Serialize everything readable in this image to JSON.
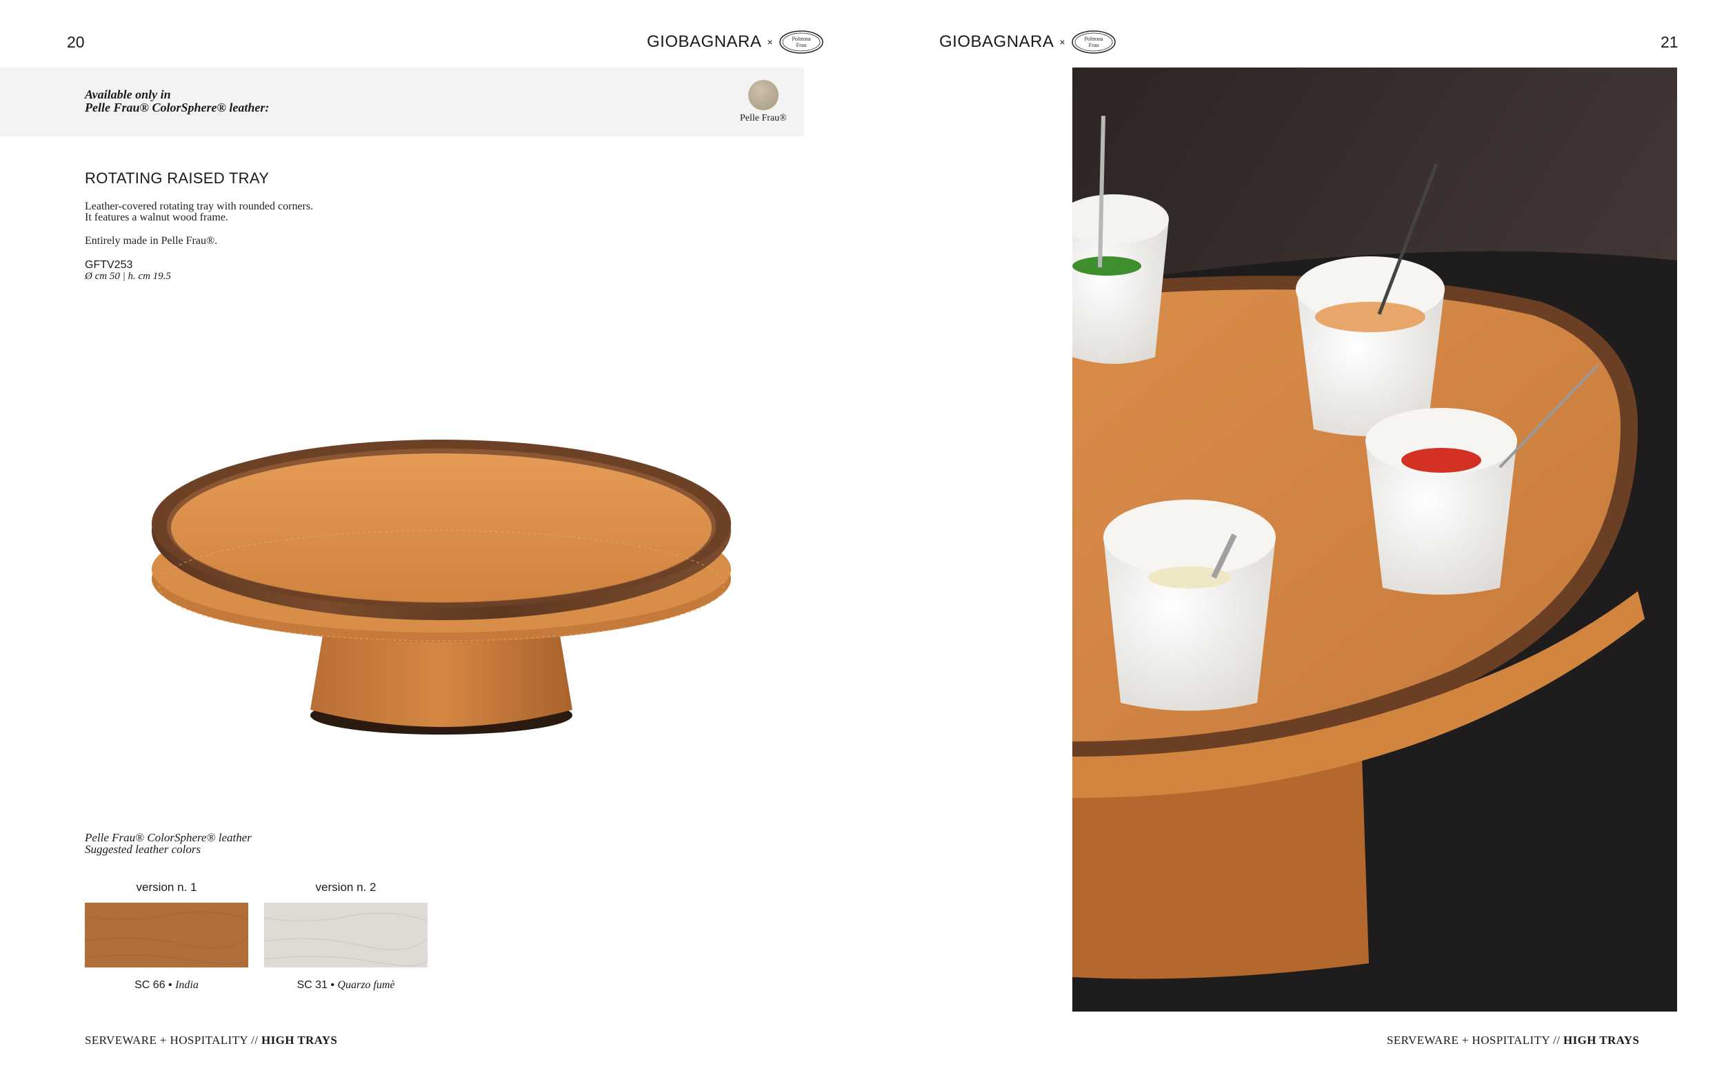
{
  "left_page": {
    "page_number": "20",
    "brand": {
      "name": "GIOBAGNARA",
      "separator": "×",
      "partner_logo": "poltrona-frau-logo",
      "partner_text": [
        "Poltrona",
        "Frau"
      ]
    },
    "availability": {
      "line1": "Available only in",
      "line2": "Pelle Frau® ColorSphere® leather:",
      "swatch_label": "Pelle Frau®",
      "swatch_color": "#b8ab94"
    },
    "product": {
      "title": "ROTATING RAISED TRAY",
      "description_line1": "Leather-covered rotating tray with rounded corners.",
      "description_line2": "It features a walnut wood frame.",
      "material_note": "Entirely made in Pelle Frau®.",
      "code": "GFTV253",
      "dimensions": "Ø cm 50 | h. cm 19.5"
    },
    "colors": {
      "caption_line1": "Pelle Frau® ColorSphere® leather",
      "caption_line2": "Suggested leather colors",
      "versions": [
        {
          "label": "version n. 1",
          "code": "SC 66 •",
          "name": "India",
          "color": "#b8743c"
        },
        {
          "label": "version n. 2",
          "code": "SC 31 •",
          "name": "Quarzo fumè",
          "color": "#dddbd3"
        }
      ]
    },
    "footer": {
      "section": "SERVEWARE + HOSPITALITY //",
      "category": "HIGH TRAYS"
    }
  },
  "right_page": {
    "page_number": "21",
    "brand": {
      "name": "GIOBAGNARA",
      "separator": "×",
      "partner_logo": "poltrona-frau-logo",
      "partner_text": [
        "Poltrona",
        "Frau"
      ]
    },
    "footer": {
      "section": "SERVEWARE + HOSPITALITY //",
      "category": "HIGH TRAYS"
    }
  },
  "colors": {
    "leather_orange": "#d08a4c",
    "walnut": "#6b4228",
    "band_gray": "#f3f3f3"
  }
}
